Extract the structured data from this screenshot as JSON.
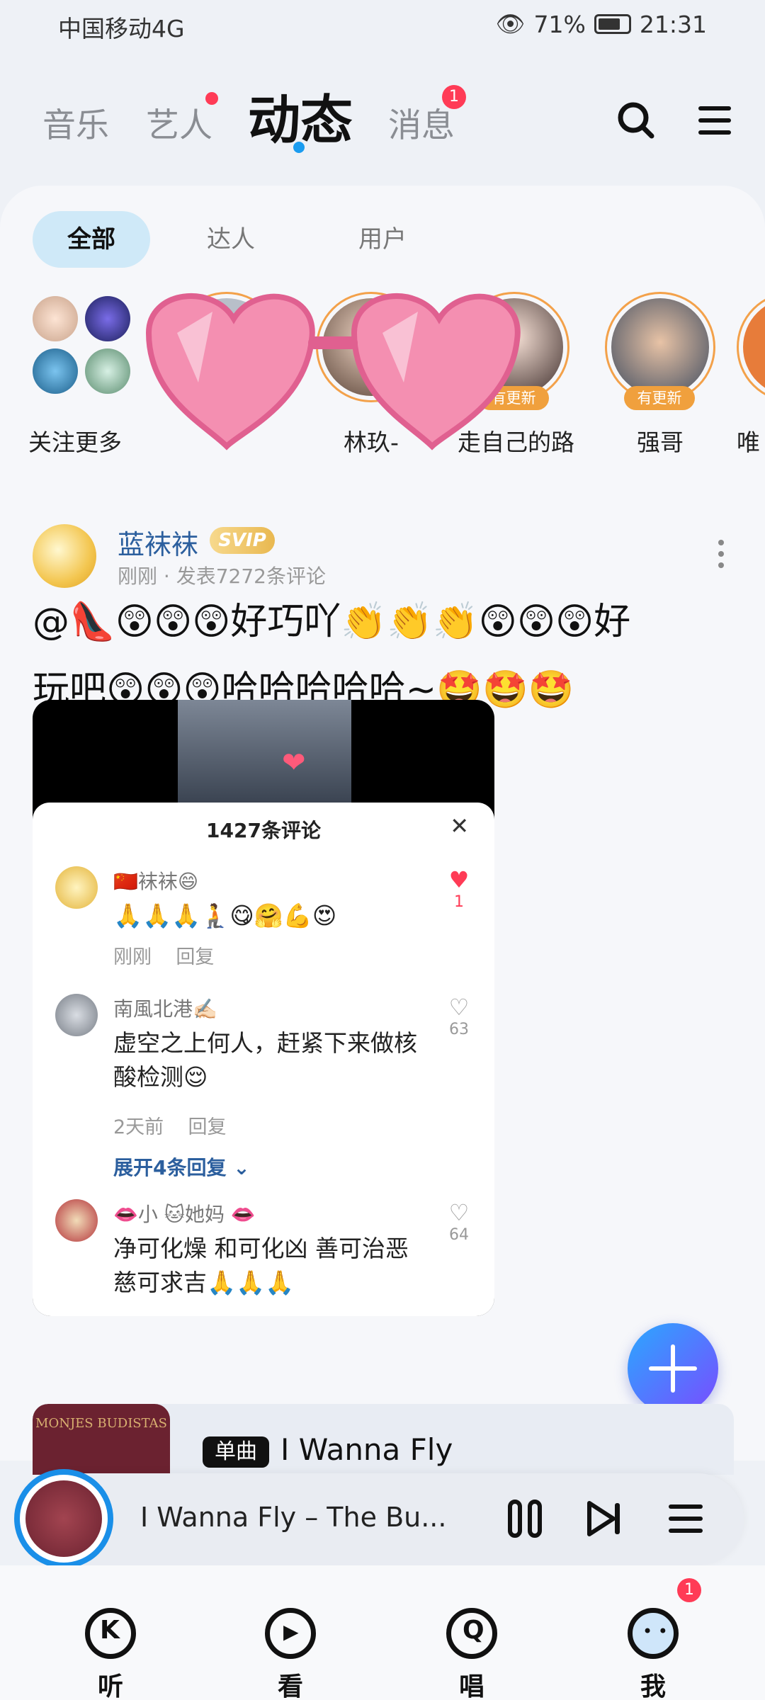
{
  "status_bar": {
    "carrier": "中国移动4G",
    "battery": "71%",
    "time": "21:31"
  },
  "top_nav": {
    "tabs": [
      {
        "label": "音乐"
      },
      {
        "label": "艺人"
      },
      {
        "label": "动态"
      },
      {
        "label": "消息",
        "badge": "1"
      }
    ],
    "active_tab": "动态"
  },
  "sub_tabs": [
    "全部",
    "达人",
    "用户"
  ],
  "stories": {
    "follow_more_label": "关注更多",
    "items": [
      {
        "label": "",
        "badge": ""
      },
      {
        "label": "林玖-",
        "badge": ""
      },
      {
        "label": "走自己的路",
        "badge": "有更新"
      },
      {
        "label": "强哥",
        "badge": "有更新"
      },
      {
        "label": "唯",
        "badge": ""
      }
    ]
  },
  "post": {
    "username": "蓝袜袜",
    "vip_badge": "SVIP",
    "meta": "刚刚 · 发表7272条评论",
    "content_line1": "@👠😲😲😲好巧吖👏👏👏😲😲😲好",
    "content_line2": "玩吧😲😲😲哈哈哈哈哈~🤩🤩🤩",
    "comment_sheet": {
      "title": "1427条评论",
      "comments": [
        {
          "name": "🇨🇳袜袜😄",
          "text": "🙏🙏🙏🧎😋🤗💪😍",
          "time": "刚刚",
          "reply": "回复",
          "likes": "1",
          "liked": true
        },
        {
          "name": "南風北港✍🏻",
          "text": "虚空之上何人，赶紧下来做核酸检测😌",
          "time": "2天前",
          "reply": "回复",
          "likes": "63",
          "liked": false
        },
        {
          "name": "👄小 🐱她妈 👄",
          "text": "净可化燥 和可化凶 善可治恶 慈可求吉🙏🙏🙏",
          "time": "",
          "reply": "",
          "likes": "64",
          "liked": false
        }
      ],
      "expand_label": "展开4条回复"
    }
  },
  "song_card": {
    "cover_text": "MONJES BUDISTAS",
    "type_label": "单曲",
    "title": "I Wanna Fly"
  },
  "player": {
    "now_playing": "I Wanna Fly  –  The Bu..."
  },
  "bottom_nav": [
    {
      "label": "听",
      "icon": "k-listen-icon"
    },
    {
      "label": "看",
      "icon": "play-watch-icon"
    },
    {
      "label": "唱",
      "icon": "sing-icon"
    },
    {
      "label": "我",
      "icon": "profile-icon",
      "badge": "1"
    }
  ],
  "colors": {
    "accent_blue": "#1a9cf0",
    "badge_red": "#ff3b56",
    "update_orange": "#f0a03d",
    "link_blue": "#2c5f9e"
  }
}
